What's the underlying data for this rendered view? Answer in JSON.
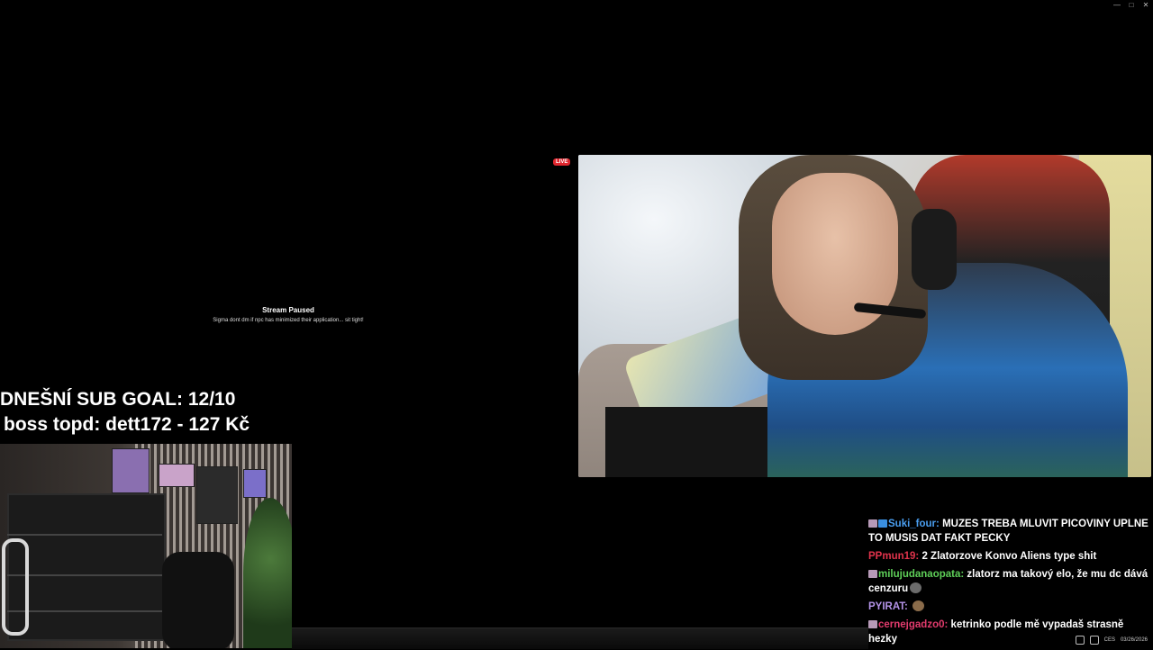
{
  "window": {
    "min_icon": "minimize-icon",
    "max_icon": "maximize-icon",
    "close_icon": "close-icon",
    "min_glyph": "—",
    "max_glyph": "□",
    "close_glyph": "✕"
  },
  "stream": {
    "paused_title": "Stream Paused",
    "paused_message": "Sigma dont dm if npc has minimized their application... sit tight!",
    "live_badge": "LIVE"
  },
  "overlay": {
    "sub_goal": "DNEŠNÍ SUB GOAL: 12/10",
    "top_donator": "boss topd:  dett172 - 127 Kč"
  },
  "chat": {
    "messages": [
      {
        "user": "Suki_four",
        "user_color": "#4a9ef0",
        "text": "MUZES TREBA MLUVIT PICOVINY UPLNE TO MUSIS DAT FAKT PECKY",
        "badges": true
      },
      {
        "user": "PPmun19",
        "user_color": "#e0334b",
        "text": "2 Zlatorzove Konvo Aliens type shit",
        "badges": false
      },
      {
        "user": "milujudanaopata",
        "user_color": "#5ecf58",
        "text": "zlatorz ma takový elo, že mu dc dává cenzuru",
        "badges": true
      },
      {
        "user": "PYIRAT",
        "user_color": "#b493e8",
        "text": "",
        "badges": false
      },
      {
        "user": "cernejgadzo0",
        "user_color": "#e23b6d",
        "text": "ketrinko podle mě vypadaš strasně hezky",
        "badges": true
      }
    ]
  },
  "taskbar": {
    "lang": "CES",
    "date": "03/26/2026"
  }
}
